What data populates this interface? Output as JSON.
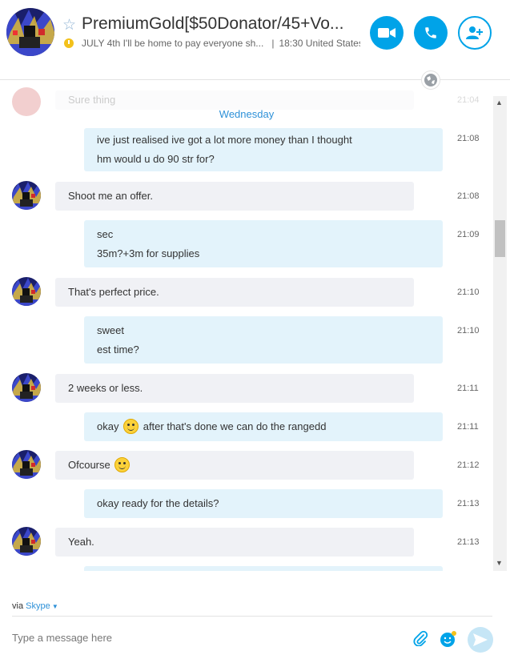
{
  "header": {
    "title": "PremiumGold[$50Donator/45+Vo...",
    "mood": "JULY 4th I'll be home to pay everyone sh...",
    "separator": "|",
    "local_time": "18:30 United States"
  },
  "chat": {
    "faded_message": {
      "text": "Sure thing",
      "time": "21:04"
    },
    "day_label": "Wednesday",
    "messages": [
      {
        "dir": "out",
        "lines": [
          "ive just realised ive got a lot more money than I thought",
          "hm would u do 90 str for?"
        ],
        "time": "21:08"
      },
      {
        "dir": "in",
        "text": "Shoot me an offer.",
        "time": "21:08"
      },
      {
        "dir": "out",
        "lines": [
          "sec",
          "35m?+3m for supplies"
        ],
        "time": "21:09"
      },
      {
        "dir": "in",
        "text": "That's perfect price.",
        "time": "21:10"
      },
      {
        "dir": "out",
        "lines": [
          "sweet",
          "est time?"
        ],
        "time": "21:10"
      },
      {
        "dir": "in",
        "text": "2 weeks or less.",
        "time": "21:11"
      },
      {
        "dir": "out",
        "before": "okay",
        "after": "after that's done we can do the rangedd",
        "time": "21:11"
      },
      {
        "dir": "in",
        "text": "Ofcourse",
        "time": "21:12"
      },
      {
        "dir": "out",
        "text": "okay ready for the details?",
        "time": "21:13"
      },
      {
        "dir": "in",
        "text": "Yeah.",
        "time": "21:13"
      }
    ]
  },
  "footer": {
    "via_label": "via",
    "service": "Skype",
    "placeholder": "Type a message here"
  },
  "icons": {
    "video": "video-camera-icon",
    "call": "phone-icon",
    "add_contact": "add-person-icon",
    "favorite": "star-icon",
    "globe": "globe-icon",
    "attach": "paperclip-icon",
    "emoticon": "emoticon-icon",
    "send": "send-icon"
  },
  "colors": {
    "accent": "#00a3e8",
    "incoming_bubble": "#f0f1f5",
    "outgoing_bubble": "#e3f3fb",
    "day_label": "#2e91d8"
  }
}
